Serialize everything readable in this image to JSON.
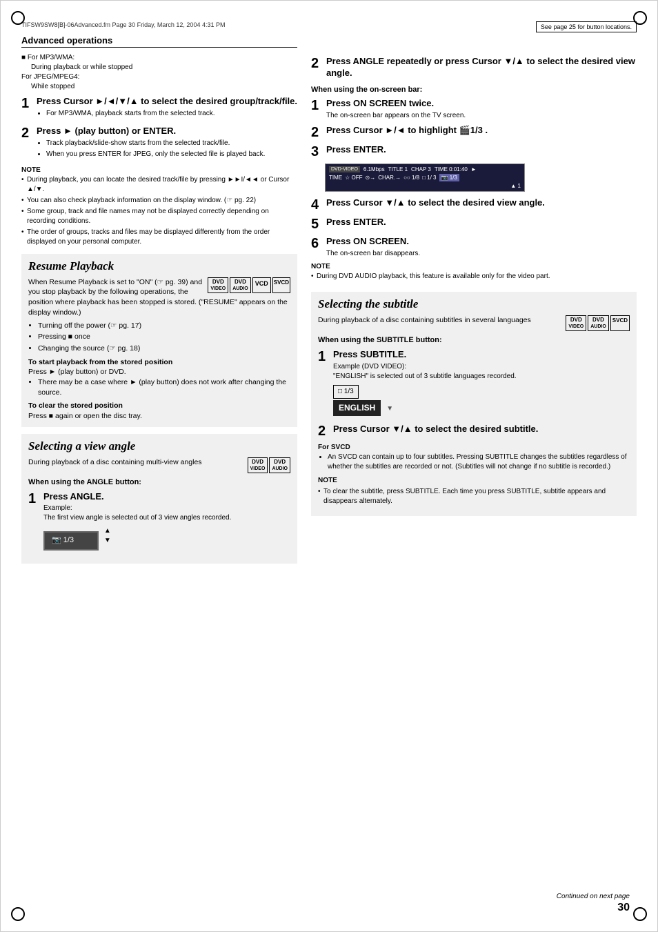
{
  "page": {
    "number": "30",
    "continued_text": "Continued on next page",
    "file_info": "TIFSW9SW8[B]-06Advanced.fm  Page 30  Friday, March 12, 2004  4:31 PM",
    "see_page": "See page 25 for button locations."
  },
  "advanced_operations": {
    "title": "Advanced operations",
    "mp3_wma_label": "For MP3/WMA:",
    "mp3_wma_text": "During playback or while stopped",
    "jpeg_label": "For JPEG/MPEG4:",
    "jpeg_text": "While stopped",
    "step1_num": "1",
    "step1_header": "Press Cursor ►/◄/▼/▲ to select the desired group/track/file.",
    "step1_sub1": "For MP3/WMA, playback starts from the selected track.",
    "step2_num": "2",
    "step2_header": "Press ► (play button) or ENTER.",
    "step2_sub1": "Track playback/slide-show starts from the selected track/file.",
    "step2_sub2": "When you press ENTER for JPEG, only the selected file is played back.",
    "note_title": "NOTE",
    "note_items": [
      "During playback, you can locate the desired track/file by pressing ►►I/◄◄ or Cursor ▲/▼.",
      "You can also check playback information on the display window. (☞ pg. 22)",
      "Some group, track and file names may not be displayed correctly depending on recording conditions.",
      "The order of groups, tracks and files may be displayed differently from the order displayed on your personal computer."
    ]
  },
  "resume_playback": {
    "section_title": "Resume Playback",
    "intro": "When Resume Playback is set to \"ON\" (☞ pg. 39) and you stop playback by the following operations, the position where playback has been stopped is stored. (\"RESUME\" appears on the display window.)",
    "bullets": [
      "Turning off the power (☞ pg. 17)",
      "Pressing ■ once",
      "Changing the source (☞ pg. 18)"
    ],
    "stored_title": "To start playback from the stored position",
    "stored_text": "Press ► (play button) or DVD.",
    "stored_note": "There may be a case where ► (play button) does not work after changing the source.",
    "clear_title": "To clear the stored position",
    "clear_text": "Press ■ again or open the disc tray."
  },
  "selecting_view_angle": {
    "section_title": "Selecting a view angle",
    "intro": "During playback of a disc containing multi-view angles",
    "angle_button_title": "When using the ANGLE button:",
    "step1_num": "1",
    "step1_header": "Press ANGLE.",
    "step1_example_label": "Example:",
    "step1_example_text": "The first view angle is selected out of 3 view angles recorded.",
    "angle_display": "🎬1/3",
    "step2_num": "2",
    "step2_header": "Press ANGLE repeatedly or press Cursor ▼/▲ to select the desired view angle.",
    "onscreen_title": "When using the on-screen bar:",
    "step_a_num": "1",
    "step_a_header": "Press ON SCREEN twice.",
    "step_a_body": "The on-screen bar appears on the TV screen.",
    "step_b_num": "2",
    "step_b_header": "Press Cursor ►/◄ to highlight 🎬1/3 .",
    "step_c_num": "3",
    "step_c_header": "Press ENTER.",
    "onscreen_bar": {
      "row1": [
        "DVD-VIDEO",
        "6.1Mbps",
        "TITLE 1",
        "CHAP 3",
        "TIME 0:01:40",
        "►"
      ],
      "row2": [
        "TIME",
        "☆ OFF",
        "⊙→",
        "CHAR.→",
        "◯◯ 1/8",
        "□ 1/3",
        "🎬 1/3"
      ]
    },
    "step_d_num": "4",
    "step_d_header": "Press Cursor ▼/▲ to select the desired view angle.",
    "step_e_num": "5",
    "step_e_header": "Press ENTER.",
    "step_f_num": "6",
    "step_f_header": "Press ON SCREEN.",
    "step_f_body": "The on-screen bar disappears.",
    "angle_note": "During DVD AUDIO playback, this feature is available only for the video part."
  },
  "selecting_subtitle": {
    "section_title": "Selecting the subtitle",
    "intro": "During playback of a disc containing subtitles in several languages",
    "subtitle_button_title": "When using the SUBTITLE button:",
    "step1_num": "1",
    "step1_header": "Press SUBTITLE.",
    "example_label": "Example (DVD VIDEO):",
    "example_text": "\"ENGLISH\" is selected out of 3 subtitle languages recorded.",
    "subtitle_num_display": "□ 1/3",
    "subtitle_text_display": "ENGLISH",
    "step2_num": "2",
    "step2_header": "Press Cursor ▼/▲ to select the desired subtitle.",
    "svcd_label": "For SVCD",
    "svcd_text": "An SVCD can contain up to four subtitles. Pressing SUBTITLE changes the subtitles regardless of whether the subtitles are recorded or not. (Subtitles will not change if no subtitle is recorded.)",
    "note_title": "NOTE",
    "note_text": "To clear the subtitle, press SUBTITLE. Each time you press SUBTITLE, subtitle appears and disappears alternately."
  },
  "badges": {
    "dvd_video": "DVD\nVIDEO",
    "dvd_audio": "DVD\nAUDIO",
    "vcd": "VCD",
    "svcd": "SVCD"
  }
}
